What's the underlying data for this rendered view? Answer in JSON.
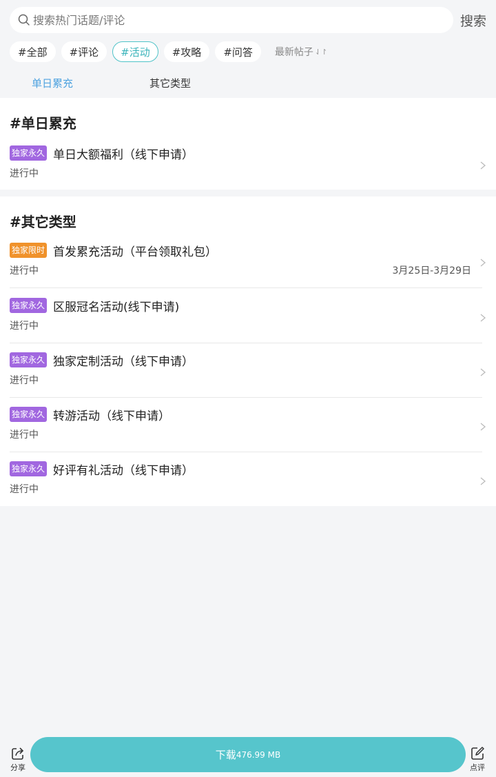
{
  "search": {
    "placeholder": "搜索热门话题/评论",
    "button_label": "搜索"
  },
  "tags": [
    {
      "label": "#全部",
      "active": false
    },
    {
      "label": "#评论",
      "active": false
    },
    {
      "label": "#活动",
      "active": true
    },
    {
      "label": "#攻略",
      "active": false
    },
    {
      "label": "#问答",
      "active": false
    }
  ],
  "sort": {
    "label": "最新帖子",
    "icon": "sort-arrows-icon"
  },
  "sub_tabs": [
    {
      "label": "单日累充",
      "active": true
    },
    {
      "label": "其它类型",
      "active": false
    }
  ],
  "sections": [
    {
      "title": "#单日累充",
      "items": [
        {
          "badge": "独家永久",
          "badge_color": "#a167e0",
          "title": "单日大额福利（线下申请）",
          "status": "进行中",
          "date": ""
        }
      ]
    },
    {
      "title": "#其它类型",
      "items": [
        {
          "badge": "独家限时",
          "badge_color": "#f0922b",
          "title": "首发累充活动（平台领取礼包）",
          "status": "进行中",
          "date": "3月25日-3月29日"
        },
        {
          "badge": "独家永久",
          "badge_color": "#a167e0",
          "title": "区服冠名活动(线下申请)",
          "status": "进行中",
          "date": ""
        },
        {
          "badge": "独家永久",
          "badge_color": "#a167e0",
          "title": "独家定制活动（线下申请）",
          "status": "进行中",
          "date": ""
        },
        {
          "badge": "独家永久",
          "badge_color": "#a167e0",
          "title": "转游活动（线下申请）",
          "status": "进行中",
          "date": ""
        },
        {
          "badge": "独家永久",
          "badge_color": "#a167e0",
          "title": "好评有礼活动（线下申请）",
          "status": "进行中",
          "date": ""
        }
      ]
    }
  ],
  "bottom_bar": {
    "share_label": "分享",
    "download_label": "下载",
    "download_size": "476.99 MB",
    "review_label": "点评",
    "accent_color": "#56c5cc"
  }
}
